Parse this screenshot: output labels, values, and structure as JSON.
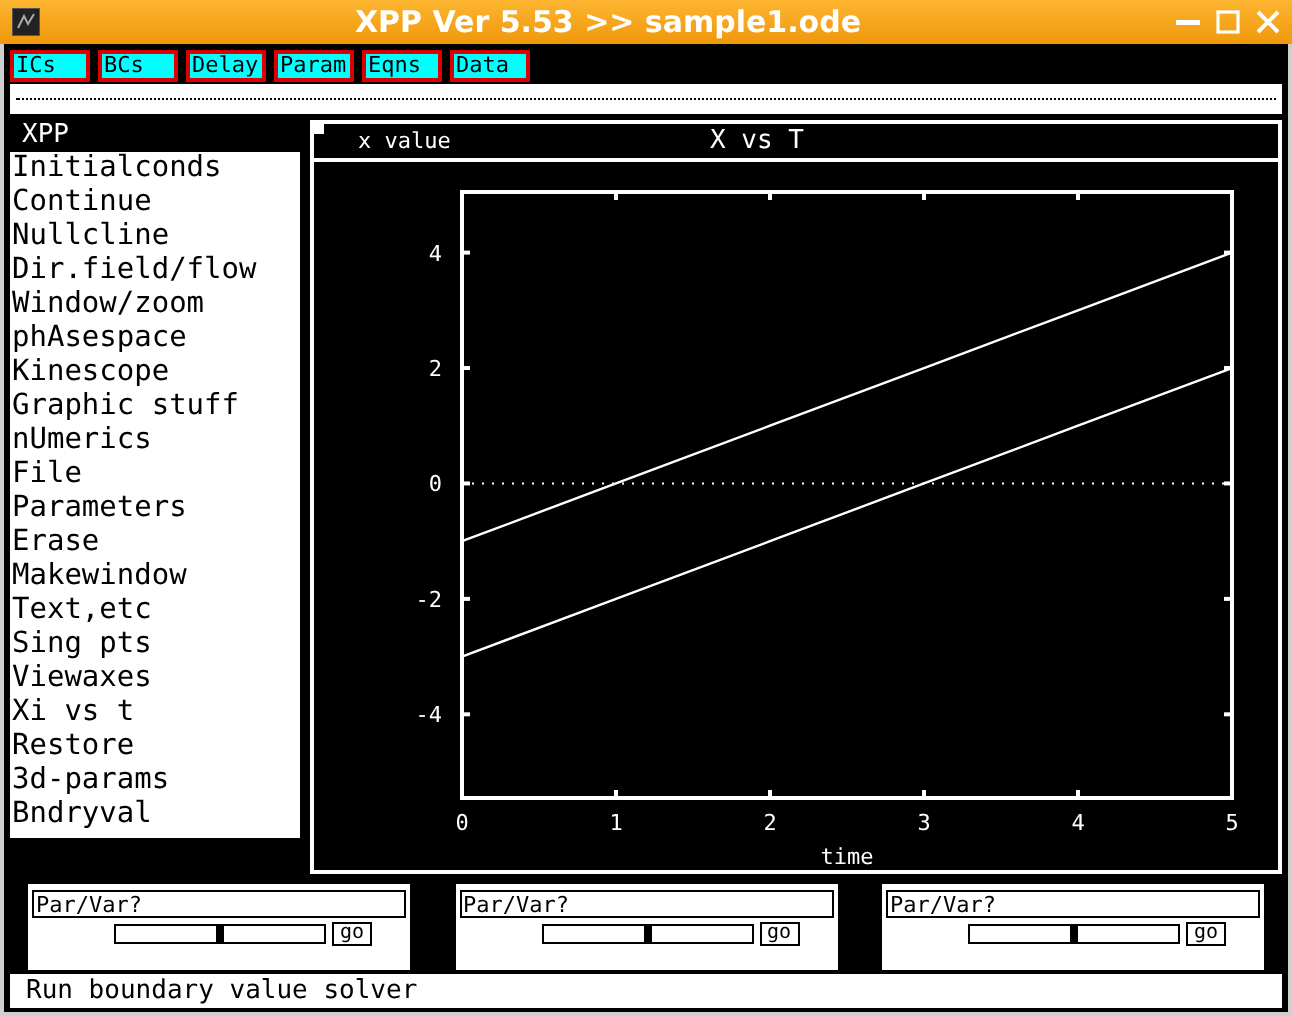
{
  "window": {
    "title": "XPP Ver 5.53 >> sample1.ode"
  },
  "toolbar": [
    "ICs",
    "BCs",
    "Delay",
    "Param",
    "Eqns",
    "Data"
  ],
  "menu": {
    "title": "XPP",
    "items": [
      "Initialconds",
      "Continue",
      "Nullcline",
      "Dir.field/flow",
      "Window/zoom",
      "phAsespace",
      "Kinescope",
      "Graphic stuff",
      "nUmerics",
      "File",
      "Parameters",
      "Erase",
      "Makewindow",
      "Text,etc",
      "Sing pts",
      "Viewaxes",
      "Xi vs t",
      "Restore",
      "3d-params",
      "Bndryval"
    ]
  },
  "plot": {
    "chart_data": {
      "type": "line",
      "title": "X vs T",
      "xlabel": "time",
      "ylabel": "x value",
      "x": [
        0,
        1,
        2,
        3,
        4,
        5
      ],
      "series": [
        {
          "color": "#ffffff",
          "values": [
            -1,
            0,
            1,
            2,
            3,
            4
          ]
        },
        {
          "color": "#ffffff",
          "values": [
            -3,
            -2,
            -1,
            0,
            1,
            2
          ]
        }
      ],
      "xlim": [
        0,
        5
      ],
      "ylim": [
        -5.45,
        5.05
      ],
      "xticks": [
        0,
        1,
        2,
        3,
        4,
        5
      ],
      "yticks": [
        -4,
        -2,
        0,
        2,
        4
      ]
    }
  },
  "sliders": [
    {
      "label": "Par/Var?",
      "level": 0.5,
      "button": "go"
    },
    {
      "label": "Par/Var?",
      "level": 0.5,
      "button": "go"
    },
    {
      "label": "Par/Var?",
      "level": 0.5,
      "button": "go"
    }
  ],
  "status_bar": "Run boundary value solver"
}
